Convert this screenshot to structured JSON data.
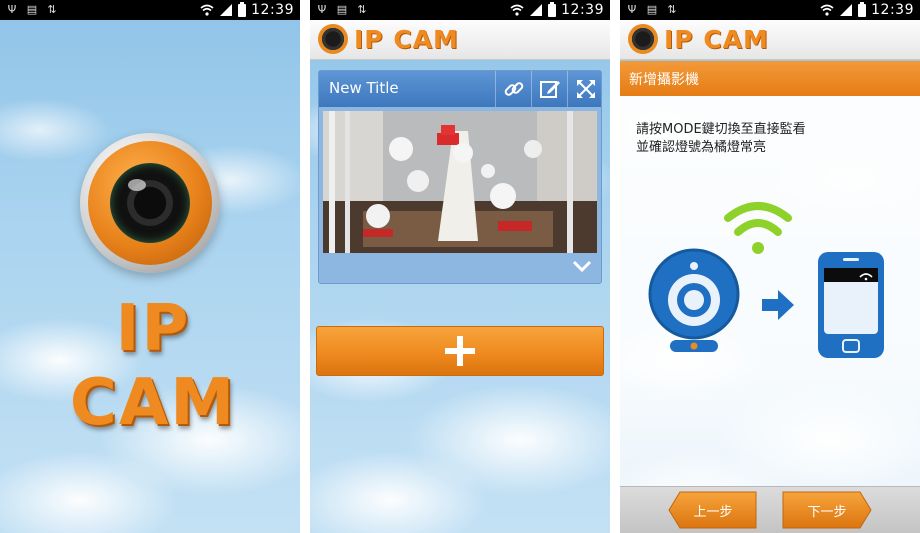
{
  "status_bar": {
    "time": "12:39"
  },
  "splash": {
    "logo_text": "IP CAM"
  },
  "camera_list": {
    "header_logo": "IP CAM",
    "card_title": "New Title",
    "add_label": "+"
  },
  "add_camera": {
    "header_logo": "IP CAM",
    "page_title": "新增攝影機",
    "instruction_line1": "請按MODE鍵切換至直接監看",
    "instruction_line2": "並確認燈號為橘燈常亮",
    "prev_label": "上一步",
    "next_label": "下一步"
  },
  "colors": {
    "brand_orange": "#ee8a1f",
    "card_blue": "#3d77bd",
    "illustration_blue": "#1f6fc2",
    "wifi_green": "#8fd12b"
  }
}
